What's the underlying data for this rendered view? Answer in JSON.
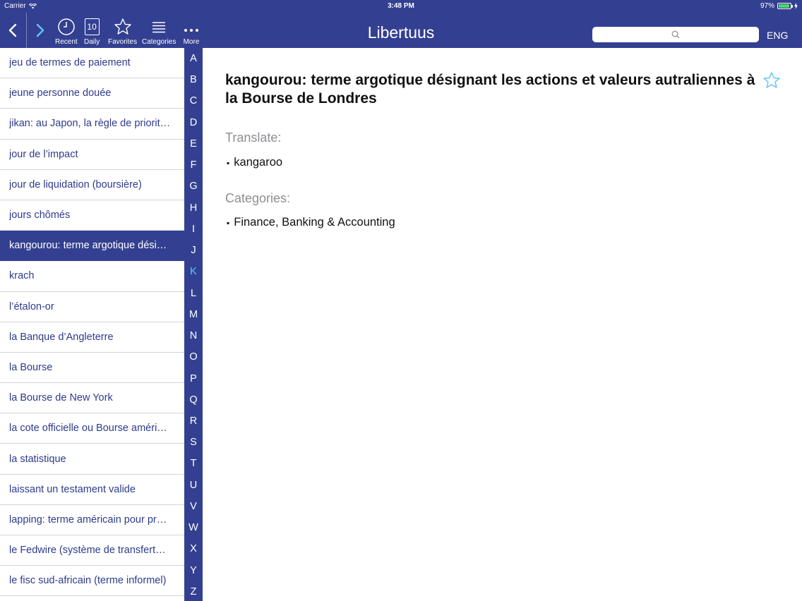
{
  "status": {
    "carrier": "Carrier",
    "time": "3:48 PM",
    "battery": "97%"
  },
  "toolbar": {
    "recent_label": "Recent",
    "daily_label": "Daily",
    "daily_number": "10",
    "favorites_label": "Favorites",
    "categories_label": "Categories",
    "more_label": "More"
  },
  "header": {
    "title": "Libertuus",
    "language": "ENG",
    "search_value": "",
    "search_icon": "search-icon"
  },
  "list": {
    "items": [
      "jeu de termes de paiement",
      "jeune personne douée",
      "jikan: au Japon, la règle de priorit…",
      "jour de l’impact",
      "jour de liquidation (boursière)",
      "jours chômés",
      "kangourou: terme argotique dési…",
      "krach",
      "l’étalon-or",
      "la Banque d’Angleterre",
      "la Bourse",
      "la Bourse de New York",
      "la cote officielle ou Bourse améri…",
      "la statistique",
      "laissant un testament valide",
      "lapping: terme américain pour pr…",
      "le Fedwire (système de transfert…",
      "le fisc sud-africain (terme informel)"
    ],
    "selected_index": 6
  },
  "index": {
    "letters": [
      "A",
      "B",
      "C",
      "D",
      "E",
      "F",
      "G",
      "H",
      "I",
      "J",
      "K",
      "L",
      "M",
      "N",
      "O",
      "P",
      "Q",
      "R",
      "S",
      "T",
      "U",
      "V",
      "W",
      "X",
      "Y",
      "Z"
    ],
    "active": "K"
  },
  "detail": {
    "term": "kangourou: terme argotique désignant les actions et valeurs autraliennes à la Bourse de Londres",
    "translate_label": "Translate:",
    "translation": "kangaroo",
    "categories_label": "Categories:",
    "category": "Finance, Banking & Accounting"
  },
  "colors": {
    "brand": "#334091",
    "active_letter": "#5bc8f5",
    "battery": "#4cd964",
    "star": "#5bc8f5"
  }
}
